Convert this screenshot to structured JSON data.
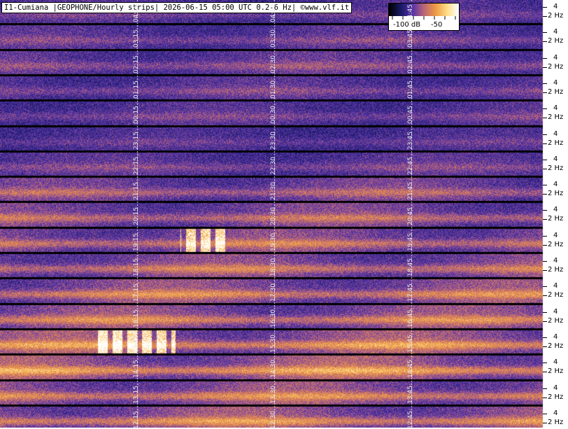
{
  "title": "I1-Cumiana |GEOPHONE/Hourly strips| 2026-06-15 05:00 UTC 0.2-6 Hz| ©www.vlf.it",
  "colorbar": {
    "labels": [
      "-100 dB",
      "-50"
    ],
    "stops": [
      "#000000",
      "#1a1a66",
      "#5533aa",
      "#bb6677",
      "#ee9944",
      "#ffdd88",
      "#ffffff"
    ]
  },
  "chart_data": {
    "type": "heatmap",
    "title": "I1-Cumiana |GEOPHONE/Hourly strips| 2026-06-15 05:00 UTC 0.2-6 Hz| ©www.vlf.it",
    "xlabel": "",
    "ylabel": "",
    "y_ticks": [
      "4",
      "2 Hz"
    ],
    "frequency_range_hz": [
      0.2,
      6
    ],
    "colorbar_range_db": [
      -100,
      -50
    ],
    "strips": [
      {
        "labels": [
          "04:15",
          "04:30",
          "04:45"
        ],
        "energy": 0.25
      },
      {
        "labels": [
          "03:15",
          "03:30",
          "03:45"
        ],
        "energy": 0.3
      },
      {
        "labels": [
          "02:15",
          "02:30",
          "02:45"
        ],
        "energy": 0.35
      },
      {
        "labels": [
          "01:15",
          "01:30",
          "01:45"
        ],
        "energy": 0.3
      },
      {
        "labels": [
          "00:15",
          "00:30",
          "00:45"
        ],
        "energy": 0.28
      },
      {
        "labels": [
          "23:15",
          "23:30",
          "23:45"
        ],
        "energy": 0.22
      },
      {
        "labels": [
          "22:15",
          "22:30",
          "22:45"
        ],
        "energy": 0.3
      },
      {
        "labels": [
          "21:15",
          "21:30",
          "21:45"
        ],
        "energy": 0.45
      },
      {
        "labels": [
          "20:15",
          "20:30",
          "20:45"
        ],
        "energy": 0.5
      },
      {
        "labels": [
          "19:15",
          "19:30",
          "19:45"
        ],
        "energy": 0.55,
        "burst": [
          258,
          322
        ]
      },
      {
        "labels": [
          "18:15",
          "18:30",
          "18:45"
        ],
        "energy": 0.55
      },
      {
        "labels": [
          "17:15",
          "17:30",
          "17:45"
        ],
        "energy": 0.6
      },
      {
        "labels": [
          "16:15",
          "16:30",
          "16:45"
        ],
        "energy": 0.6
      },
      {
        "labels": [
          "15:15",
          "15:30",
          "15:45"
        ],
        "energy": 0.68,
        "burst": [
          135,
          250
        ]
      },
      {
        "labels": [
          "14:15",
          "14:30",
          "14:45"
        ],
        "energy": 0.72
      },
      {
        "labels": [
          "13:15",
          "13:30",
          "13:45"
        ],
        "energy": 0.62
      },
      {
        "labels": [
          "12:15",
          "12:30",
          "12:45"
        ],
        "energy": 0.65
      }
    ]
  }
}
